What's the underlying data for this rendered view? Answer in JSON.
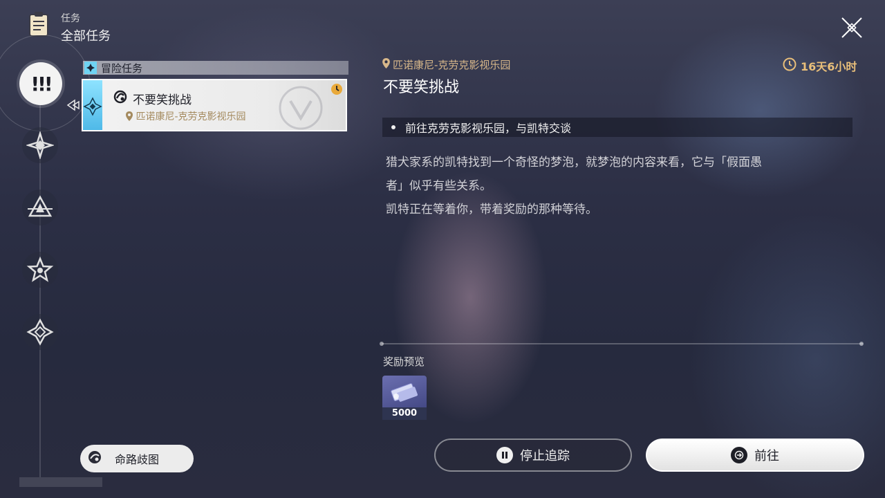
{
  "header": {
    "subtitle": "任务",
    "title": "全部任务"
  },
  "sidebar": {
    "categories": [
      "all",
      "trailblaze",
      "companion",
      "adventure",
      "daily"
    ]
  },
  "quest_list": {
    "category_label": "冒险任务",
    "items": [
      {
        "name": "不要笑挑战",
        "location": "匹诺康尼-克劳克影视乐园",
        "selected": true
      }
    ],
    "roadmap_button": "命路歧图"
  },
  "detail": {
    "location": "匹诺康尼-克劳克影视乐园",
    "timer": "16天6小时",
    "title": "不要笑挑战",
    "objective": "前往克劳克影视乐园，与凯特交谈",
    "description_lines": [
      "猎犬家系的凯特找到一个奇怪的梦泡，就梦泡的内容来看，它与「假面愚",
      "者」似乎有些关系。",
      "凯特正在等着你，带着奖励的那种等待。"
    ],
    "reward_title": "奖励预览",
    "rewards": [
      {
        "count": "5000"
      }
    ],
    "stop_button": "停止追踪",
    "go_button": "前往"
  },
  "colors": {
    "accent_gold": "#d7b78a",
    "timer": "#e9bf7a",
    "quest_stripe": "#6fd3f2"
  }
}
